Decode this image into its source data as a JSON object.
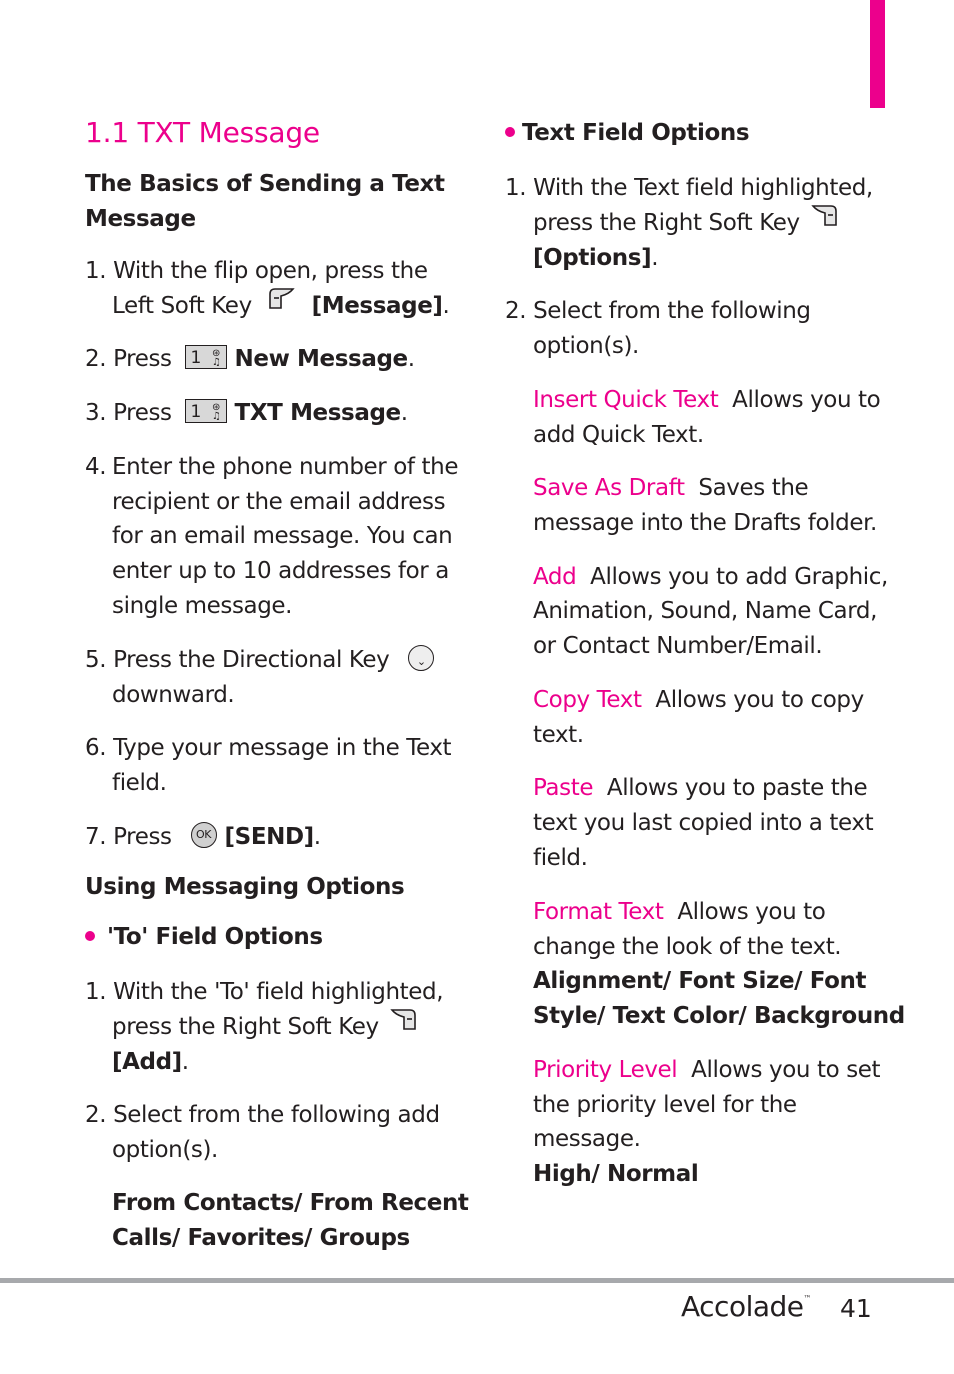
{
  "accent_color": "#ec008c",
  "section_title": "1.1 TXT Message",
  "left": {
    "subheading_basics_line1": "The Basics of Sending a Text",
    "subheading_basics_line2": "Message",
    "step1": {
      "num": "1.",
      "line1": "With the flip open, press the",
      "line2_pre": "Left Soft Key",
      "line2_bold": "[Message]",
      "line2_post": "."
    },
    "step2": {
      "num": "2.",
      "pre": "Press",
      "key_label": "1",
      "bold": "New Message",
      "post": "."
    },
    "step3": {
      "num": "3.",
      "pre": "Press",
      "key_label": "1",
      "bold": "TXT Message",
      "post": "."
    },
    "step4": {
      "num": "4.",
      "lines": [
        "Enter the phone number of the",
        "recipient or the email address",
        "for an email message. You can",
        "enter up to 10 addresses for a",
        "single message."
      ]
    },
    "step5": {
      "num": "5.",
      "line1": "Press the Directional Key",
      "line2": "downward."
    },
    "step6": {
      "num": "6.",
      "line1": "Type your message in the Text",
      "line2": "field."
    },
    "step7": {
      "num": "7.",
      "pre": "Press",
      "key_label": "OK",
      "bold": "[SEND]",
      "post": "."
    },
    "subheading_options": "Using Messaging Options",
    "to_field_heading": "'To' Field Options",
    "to_step1": {
      "num": "1.",
      "line1": "With the 'To' field highlighted,",
      "line2": "press the Right Soft Key",
      "line3_bold": "[Add]",
      "line3_post": "."
    },
    "to_step2": {
      "num": "2.",
      "line1": "Select from the following add",
      "line2": "option(s)."
    },
    "to_options_line1": "From Contacts/ From Recent",
    "to_options_line2": "Calls/ Favorites/ Groups"
  },
  "right": {
    "text_field_heading": "Text Field Options",
    "step1": {
      "num": "1.",
      "line1": "With the Text field highlighted,",
      "line2": "press the Right Soft Key",
      "line3_bold": "[Options]",
      "line3_post": "."
    },
    "step2": {
      "num": "2.",
      "line1": "Select from the following",
      "line2": "option(s)."
    },
    "options": [
      {
        "term": "Insert Quick Text",
        "desc_line1": "Allows you to",
        "desc_rest": [
          "add Quick Text."
        ]
      },
      {
        "term": "Save As Draft",
        "desc_line1": "Saves the",
        "desc_rest": [
          "message into the Drafts folder."
        ]
      },
      {
        "term": "Add",
        "desc_line1": "Allows you to add Graphic,",
        "desc_rest": [
          "Animation, Sound, Name Card,",
          "or Contact Number/Email."
        ]
      },
      {
        "term": "Copy Text",
        "desc_line1": "Allows you to copy",
        "desc_rest": [
          "text."
        ]
      },
      {
        "term": "Paste",
        "desc_line1": "Allows you to paste the",
        "desc_rest": [
          "text you last copied into a text",
          "field."
        ]
      },
      {
        "term": "Format Text",
        "desc_line1": "Allows you to",
        "desc_rest": [
          "change the look of the text."
        ],
        "values": [
          "Alignment/ Font Size/ Font",
          "Style/ Text Color/ Background"
        ]
      },
      {
        "term": "Priority Level",
        "desc_line1": "Allows you to set",
        "desc_rest": [
          "the priority level for the",
          "message."
        ],
        "values": [
          "High/ Normal"
        ]
      }
    ]
  },
  "footer": {
    "brand": "Accolade",
    "trademark": "™",
    "page_number": "41"
  },
  "icons": {
    "left_soft_key": "left-soft-key-icon",
    "right_soft_key": "right-soft-key-icon",
    "number_key": "number-1-voicemail-key-icon",
    "directional_key": "directional-key-down-icon",
    "ok_key": "ok-key-icon"
  }
}
